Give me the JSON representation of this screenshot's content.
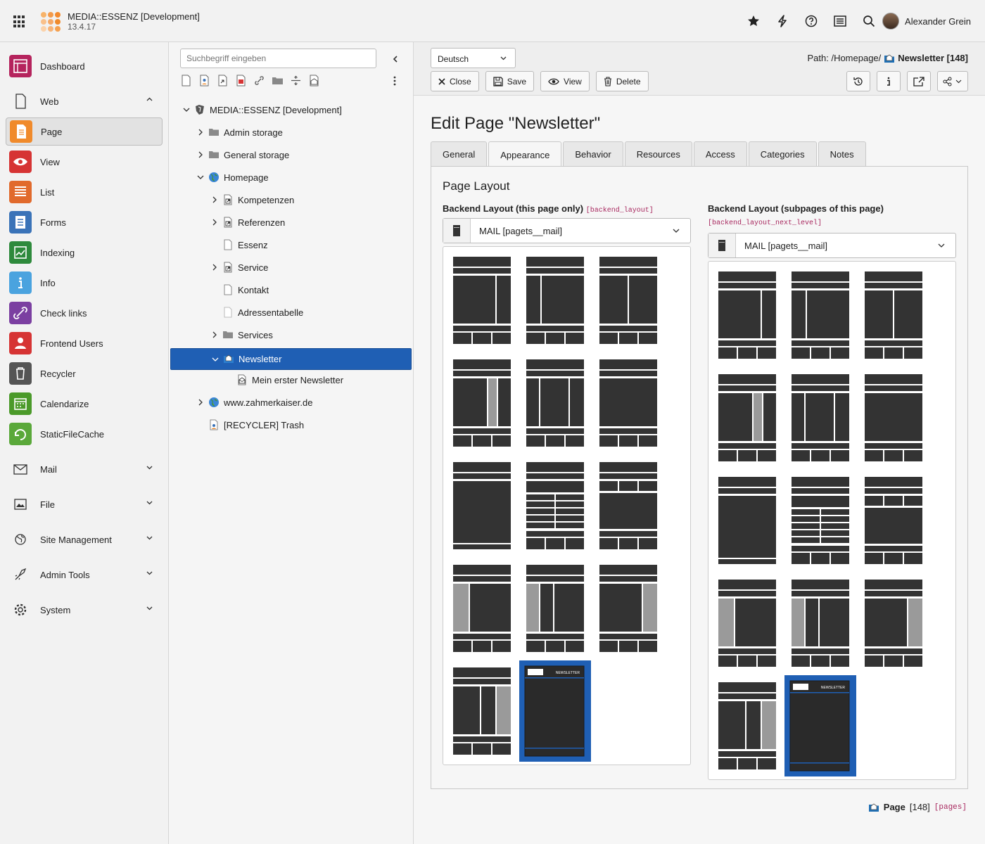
{
  "topbar": {
    "site_name": "MEDIA::ESSENZ [Development]",
    "version": "13.4.17",
    "user_name": "Alexander Grein",
    "icons": [
      "apps-icon",
      "bookmark-star-icon",
      "bolt-icon",
      "help-icon",
      "list-icon",
      "search-icon"
    ]
  },
  "modules": [
    {
      "label": "Dashboard",
      "icon": "dashboard-icon",
      "color": "#b5245d"
    },
    {
      "label": "Web",
      "icon": "web-icon",
      "group": true
    },
    {
      "label": "Page",
      "icon": "page-icon",
      "color": "#f08a2b",
      "active": true
    },
    {
      "label": "View",
      "icon": "view-icon",
      "color": "#d63434"
    },
    {
      "label": "List",
      "icon": "list-icon",
      "color": "#e16a2c"
    },
    {
      "label": "Forms",
      "icon": "forms-icon",
      "color": "#3a73b8"
    },
    {
      "label": "Indexing",
      "icon": "indexing-icon",
      "color": "#2e8a3c"
    },
    {
      "label": "Info",
      "icon": "info-icon",
      "color": "#4aa3df"
    },
    {
      "label": "Check links",
      "icon": "check-links-icon",
      "color": "#7b3fa1"
    },
    {
      "label": "Frontend Users",
      "icon": "frontend-users-icon",
      "color": "#d63434"
    },
    {
      "label": "Recycler",
      "icon": "recycler-icon",
      "color": "#555555"
    },
    {
      "label": "Calendarize",
      "icon": "calendarize-icon",
      "color": "#4b9a2a"
    },
    {
      "label": "StaticFileCache",
      "icon": "staticfilecache-icon",
      "color": "#5aa83a"
    },
    {
      "label": "Mail",
      "icon": "mail-icon",
      "group": true
    },
    {
      "label": "File",
      "icon": "file-icon",
      "group": true
    },
    {
      "label": "Site Management",
      "icon": "site-management-icon",
      "group": true
    },
    {
      "label": "Admin Tools",
      "icon": "admin-tools-icon",
      "group": true
    },
    {
      "label": "System",
      "icon": "system-icon",
      "group": true
    }
  ],
  "tree": {
    "search_placeholder": "Suchbegriff eingeben",
    "nodes": [
      {
        "label": "MEDIA::ESSENZ [Development]",
        "icon": "typo3-root-icon"
      },
      {
        "label": "Admin storage",
        "icon": "folder-icon"
      },
      {
        "label": "General storage",
        "icon": "folder-icon"
      },
      {
        "label": "Homepage",
        "icon": "globe-icon"
      },
      {
        "label": "Kompetenzen",
        "icon": "shortcut-page-icon"
      },
      {
        "label": "Referenzen",
        "icon": "shortcut-page-icon"
      },
      {
        "label": "Essenz",
        "icon": "page-doc-icon"
      },
      {
        "label": "Service",
        "icon": "shortcut-page-icon"
      },
      {
        "label": "Kontakt",
        "icon": "page-doc-icon"
      },
      {
        "label": "Adressentabelle",
        "icon": "page-doc-hidden-icon"
      },
      {
        "label": "Services",
        "icon": "folder-icon"
      },
      {
        "label": "Newsletter",
        "icon": "newsletter-folder-icon",
        "selected": true
      },
      {
        "label": "Mein erster Newsletter",
        "icon": "mail-page-icon"
      },
      {
        "label": "www.zahmerkaiser.de",
        "icon": "globe-icon"
      },
      {
        "label": "[RECYCLER] Trash",
        "icon": "recycler-page-icon"
      }
    ]
  },
  "docheader": {
    "language": "Deutsch",
    "path_prefix": "Path: /Homepage/",
    "path_page": "Newsletter [148]",
    "close": "Close",
    "save": "Save",
    "view": "View",
    "delete": "Delete"
  },
  "editor": {
    "title": "Edit Page \"Newsletter\"",
    "tabs": [
      "General",
      "Appearance",
      "Behavior",
      "Resources",
      "Access",
      "Categories",
      "Notes"
    ],
    "active_tab": "Appearance",
    "section_title": "Page Layout",
    "field1_label": "Backend Layout (this page only)",
    "field1_code": "[backend_layout]",
    "field1_value": "MAIL [pagets__mail]",
    "field2_label": "Backend Layout (subpages of this page)",
    "field2_code": "[backend_layout_next_level]",
    "field2_value": "MAIL [pagets__mail]",
    "newsletter_thumb_text": "NEWSLETTER"
  },
  "footer": {
    "record_label": "Page",
    "record_uid": "[148]",
    "record_table": "[pages]"
  },
  "colors": {
    "accent": "#1f5fb4",
    "code": "#a8285f"
  }
}
